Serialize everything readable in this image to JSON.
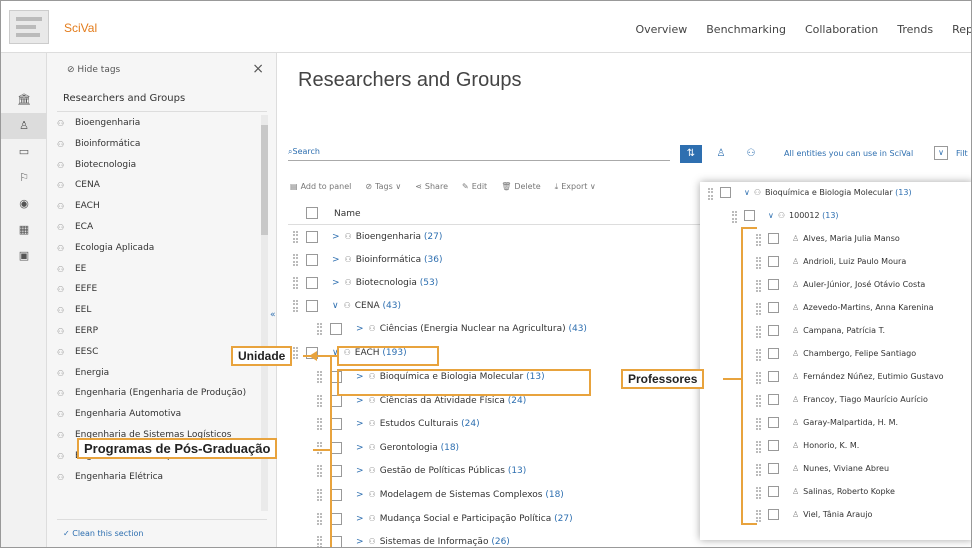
{
  "header": {
    "brand": "SciVal",
    "nav": [
      "Overview",
      "Benchmarking",
      "Collaboration",
      "Trends",
      "Rep"
    ]
  },
  "sidebar": {
    "hide_tags": "Hide tags",
    "close": "×",
    "title": "Researchers and Groups",
    "items": [
      "Bioengenharia",
      "Bioinformática",
      "Biotecnologia",
      "CENA",
      "EACH",
      "ECA",
      "Ecologia Aplicada",
      "EE",
      "EEFE",
      "EEL",
      "EERP",
      "EESC",
      "Energia",
      "Engenharia (Engenharia de Produção)",
      "Engenharia Automotiva",
      "Engenharia de Sistemas Logísticos",
      "Engenharia de Transportes",
      "Engenharia Elétrica"
    ],
    "clean": "Clean this section",
    "collapse_arrows": "«"
  },
  "main": {
    "title": "Researchers and Groups",
    "search_placeholder": "Search",
    "entities_label": "All entities you can use in SciVal",
    "filter_label": "Filt",
    "toolbar": {
      "add_to_panel": "Add to panel",
      "tags": "Tags",
      "share": "Share",
      "edit": "Edit",
      "delete": "Delete",
      "export": "Export"
    },
    "column_name": "Name",
    "rows": [
      {
        "arrow": ">",
        "name": "Bioengenharia",
        "count": "(27)"
      },
      {
        "arrow": ">",
        "name": "Bioinformática",
        "count": "(36)"
      },
      {
        "arrow": ">",
        "name": "Biotecnologia",
        "count": "(53)"
      },
      {
        "arrow": "∨",
        "name": "CENA",
        "count": "(43)"
      },
      {
        "arrow": ">",
        "name": "Ciências (Energia Nuclear na Agricultura)",
        "count": "(43)"
      },
      {
        "arrow": "∨",
        "name": "EACH",
        "count": "(193)"
      },
      {
        "arrow": ">",
        "name": "Bioquímica e Biologia Molecular",
        "count": "(13)"
      },
      {
        "arrow": ">",
        "name": "Ciências da Atividade Física",
        "count": "(24)"
      },
      {
        "arrow": ">",
        "name": "Estudos Culturais",
        "count": "(24)"
      },
      {
        "arrow": ">",
        "name": "Gerontologia",
        "count": "(18)"
      },
      {
        "arrow": ">",
        "name": "Gestão de Políticas Públicas",
        "count": "(13)"
      },
      {
        "arrow": ">",
        "name": "Modelagem de Sistemas Complexos",
        "count": "(18)"
      },
      {
        "arrow": ">",
        "name": "Mudança Social e Participação Política",
        "count": "(27)"
      },
      {
        "arrow": ">",
        "name": "Sistemas de Informação",
        "count": "(26)"
      }
    ]
  },
  "popup": {
    "group": {
      "arrow": "∨",
      "name": "Bioquímica e Biologia Molecular",
      "count": "(13)"
    },
    "subgroup": {
      "arrow": "∨",
      "name": "100012",
      "count": "(13)"
    },
    "people": [
      "Alves, Maria Julia Manso",
      "Andrioli, Luiz Paulo Moura",
      "Auler-Júnior, José Otávio Costa",
      "Azevedo-Martins, Anna Karenina",
      "Campana, Patrícia T.",
      "Chambergo, Felipe Santiago",
      "Fernández Núñez, Eutimio Gustavo",
      "Francoy, Tiago Maurício Aurício",
      "Garay-Malpartida, H. M.",
      "Honorio, K. M.",
      "Nunes, Viviane Abreu",
      "Salinas, Roberto Kopke",
      "Viel, Tânia Araujo"
    ]
  },
  "annotations": {
    "unidade": "Unidade",
    "professores": "Professores",
    "programas": "Programas de Pós-Graduação",
    "color": "#e8a33d"
  }
}
